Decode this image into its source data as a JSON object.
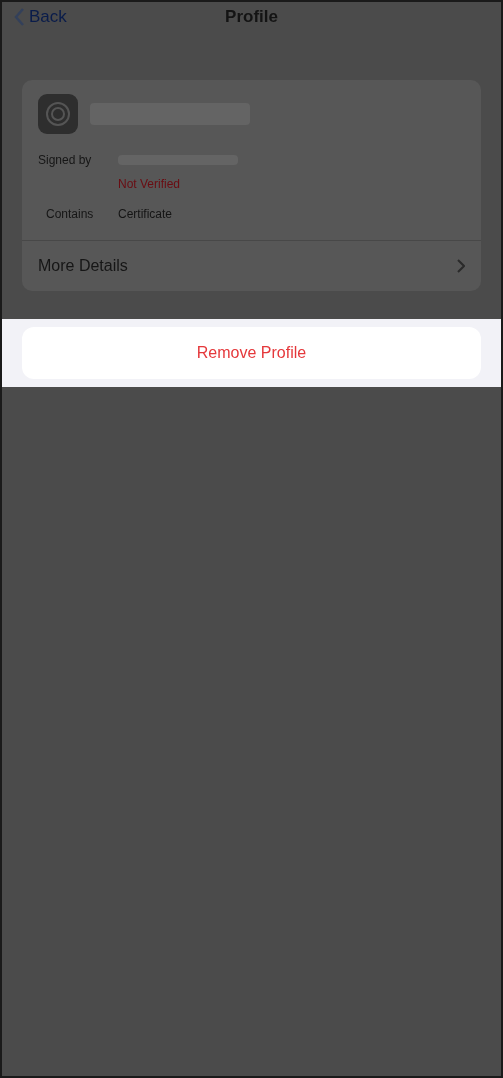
{
  "nav": {
    "back": "Back",
    "title": "Profile"
  },
  "profile": {
    "signed_by_label": "Signed by",
    "verification": "Not Verified",
    "contains_label": "Contains",
    "contains_value": "Certificate",
    "more_details": "More Details"
  },
  "action_sheet": {
    "button": "Remove Profile"
  }
}
